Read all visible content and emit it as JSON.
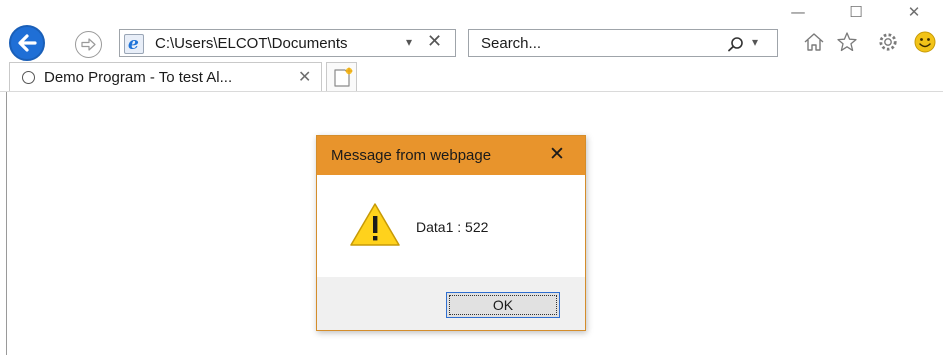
{
  "window": {
    "minimize": "—",
    "maximize": "☐",
    "close": "✕"
  },
  "nav": {
    "address": "C:\\Users\\ELCOT\\Documents",
    "address_dropdown": "▾",
    "address_clear": "✕",
    "search_placeholder": "Search...",
    "search_dropdown": "▾"
  },
  "tab": {
    "title": "Demo Program - To test Al...",
    "close": "✕"
  },
  "dialog": {
    "title": "Message from webpage",
    "close": "✕",
    "message": "Data1 : 522",
    "ok_label": "OK"
  },
  "colors": {
    "dialog_title_bar": "#e8942c",
    "back_button": "#1f6fd6"
  }
}
